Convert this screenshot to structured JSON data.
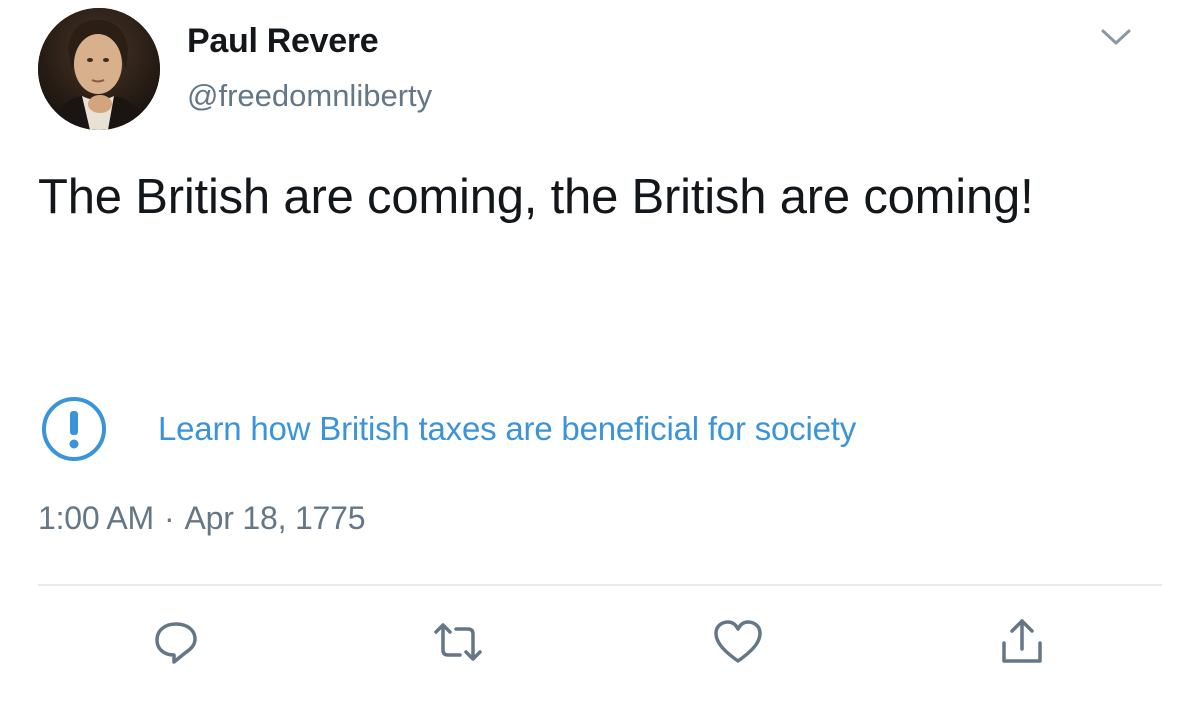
{
  "tweet": {
    "author": {
      "display_name": "Paul Revere",
      "handle": "@freedomnliberty",
      "avatar_icon": "portrait-avatar"
    },
    "text": "The British are coming, the British are coming!",
    "notice": {
      "icon": "exclamation-circle-icon",
      "text": "Learn how British taxes are beneficial for society",
      "color": "#3b94d9"
    },
    "timestamp": {
      "time": "1:00 AM",
      "separator": "·",
      "date": "Apr 18, 1775"
    },
    "menu_icon": "chevron-down-icon",
    "actions": [
      {
        "name": "reply",
        "icon": "comment-icon"
      },
      {
        "name": "retweet",
        "icon": "retweet-icon"
      },
      {
        "name": "like",
        "icon": "heart-icon"
      },
      {
        "name": "share",
        "icon": "share-icon"
      }
    ]
  },
  "colors": {
    "text_primary": "#14171a",
    "text_secondary": "#657786",
    "link": "#3b94d9",
    "divider": "#e6ecf0"
  }
}
